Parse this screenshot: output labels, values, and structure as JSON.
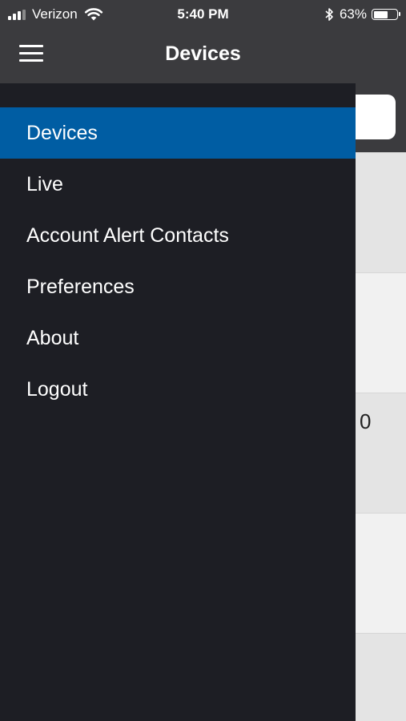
{
  "status_bar": {
    "carrier": "Verizon",
    "time": "5:40 PM",
    "battery_percent": "63%",
    "battery_level": 0.63,
    "signal_bars_filled": 3,
    "signal_bars_total": 4,
    "icons": [
      "signal-icon",
      "wifi-icon",
      "bluetooth-icon",
      "battery-icon"
    ]
  },
  "nav": {
    "title": "Devices",
    "menu_icon": "hamburger-menu-icon"
  },
  "drawer": {
    "items": [
      {
        "label": "Devices",
        "active": true
      },
      {
        "label": "Live",
        "active": false
      },
      {
        "label": "Account Alert Contacts",
        "active": false
      },
      {
        "label": "Preferences",
        "active": false
      },
      {
        "label": "About",
        "active": false
      },
      {
        "label": "Logout",
        "active": false
      }
    ],
    "active_color": "#005da3",
    "background_color": "#1d1e24"
  },
  "background": {
    "visible_row_value": "0"
  }
}
